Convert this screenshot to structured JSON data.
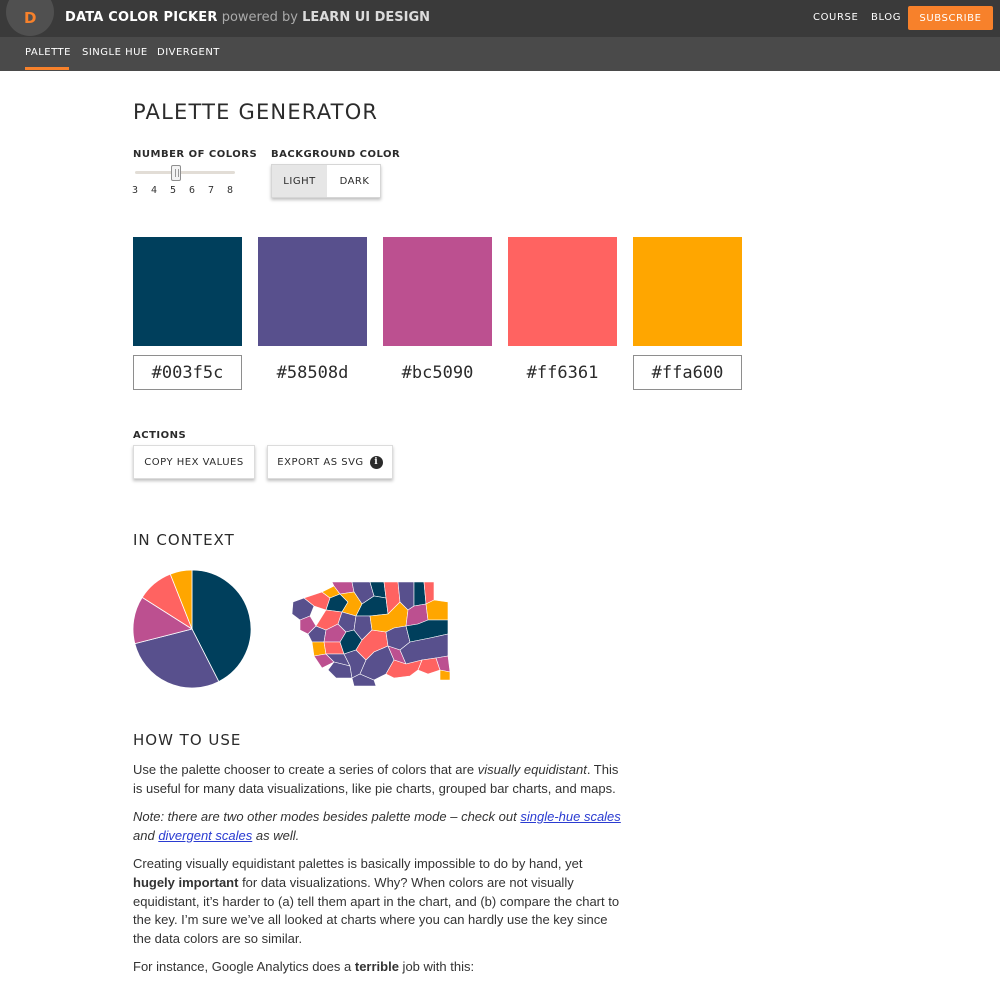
{
  "header": {
    "logo_letter": "D",
    "title": "DATA COLOR PICKER",
    "powered_by": "powered by",
    "learn": "LEARN UI DESIGN",
    "nav": [
      "COURSE",
      "BLOG"
    ],
    "subscribe": "SUBSCRIBE"
  },
  "tabs": [
    "PALETTE",
    "SINGLE HUE",
    "DIVERGENT"
  ],
  "page_title": "PALETTE GENERATOR",
  "controls": {
    "num_colors_label": "NUMBER OF COLORS",
    "num_colors_options": [
      "3",
      "4",
      "5",
      "6",
      "7",
      "8"
    ],
    "num_colors_value": 5,
    "background_label": "BACKGROUND COLOR",
    "background_options": [
      "LIGHT",
      "DARK"
    ],
    "background_selected": "LIGHT"
  },
  "palette": [
    {
      "hex": "#003f5c",
      "color": "#003f5c"
    },
    {
      "hex": "#58508d",
      "color": "#58508d"
    },
    {
      "hex": "#bc5090",
      "color": "#bc5090"
    },
    {
      "hex": "#ff6361",
      "color": "#ff6361"
    },
    {
      "hex": "#ffa600",
      "color": "#ffa600"
    }
  ],
  "actions": {
    "label": "ACTIONS",
    "copy": "COPY HEX VALUES",
    "export": "EXPORT AS SVG",
    "info_glyph": "i"
  },
  "context": {
    "title": "IN CONTEXT",
    "pie_fractions": [
      0.425,
      0.285,
      0.13,
      0.1,
      0.06
    ]
  },
  "how_to_use": {
    "title": "HOW TO USE",
    "p1_a": "Use the palette chooser to create a series of colors that are ",
    "p1_em": "visually equidistant",
    "p1_b": ". This is useful for many data visualizations, like pie charts, grouped bar charts, and maps.",
    "p2_a": "Note: there are two other modes besides palette mode – check out ",
    "p2_link1": "single-hue scales",
    "p2_b": " and ",
    "p2_link2": "divergent scales",
    "p2_c": " as well.",
    "p3_a": "Creating visually equidistant palettes is basically impossible to do by hand, yet ",
    "p3_strong": "hugely important",
    "p3_b": " for data visualizations. Why? When colors are not visually equidistant, it’s harder to (a) tell them apart in the chart, and (b) compare the chart to the key. I’m sure we’ve all looked at charts where you can hardly use the key since the data colors are so similar.",
    "p4_a": "For instance, Google Analytics does a ",
    "p4_strong": "terrible",
    "p4_b": " job with this:"
  }
}
